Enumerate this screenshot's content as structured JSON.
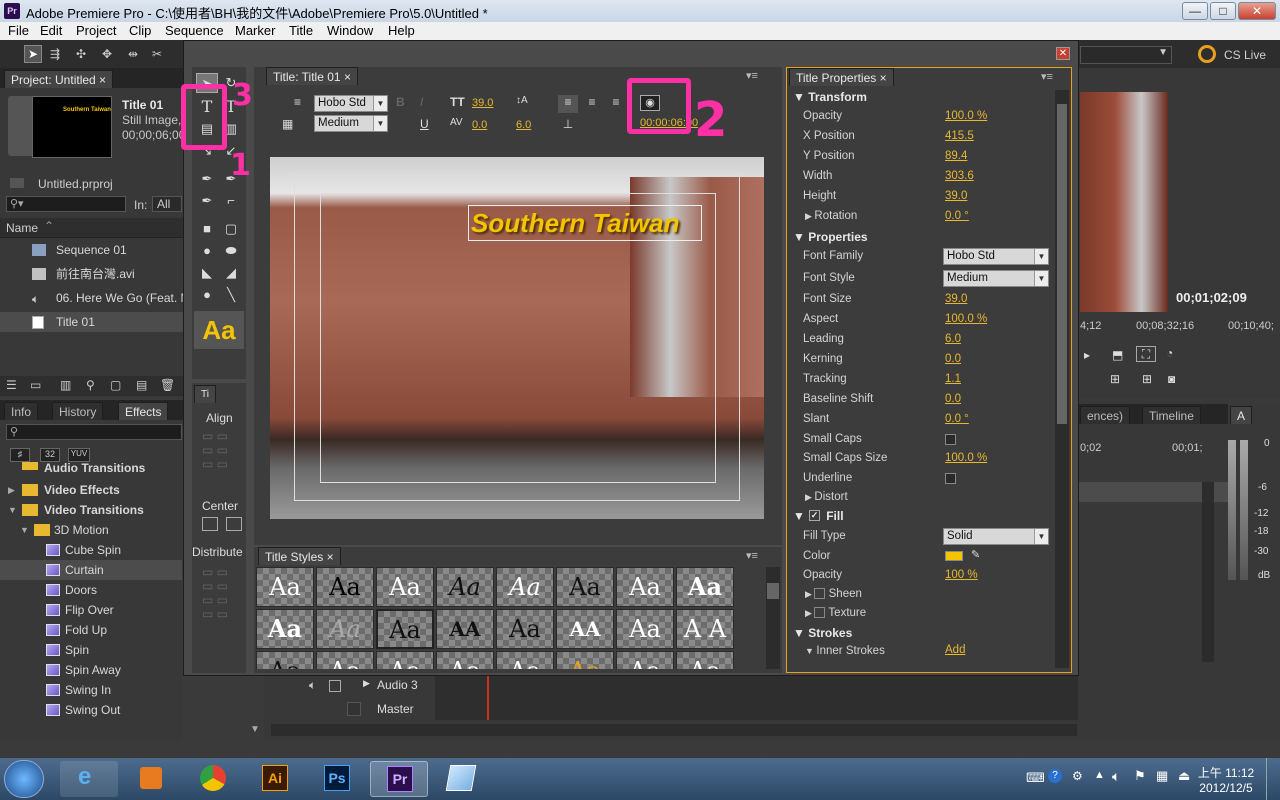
{
  "window": {
    "title": "Adobe Premiere Pro - C:\\使用者\\BH\\我的文件\\Adobe\\Premiere Pro\\5.0\\Untitled *",
    "app_icon": "Pr",
    "minimize": "—",
    "maximize": "□",
    "close": "✕"
  },
  "menu": [
    "File",
    "Edit",
    "Project",
    "Clip",
    "Sequence",
    "Marker",
    "Title",
    "Window",
    "Help"
  ],
  "cs_live": "CS Live",
  "project_panel": {
    "tab": "Project: Untitled",
    "clip_name": "Title 01",
    "clip_type": "Still Image,",
    "clip_duration": "00;00;06;00",
    "thumb_text": "Southern Taiwan",
    "project_file": "Untitled.prproj",
    "in_label": "In:",
    "in_value": "All",
    "name_header": "Name",
    "items": [
      "Sequence 01",
      "前往南台灣.avi",
      "06. Here We Go (Feat. M",
      "Title 01"
    ]
  },
  "effects_panel": {
    "tabs": [
      "Info",
      "History",
      "Effects"
    ],
    "badges": [
      "32",
      "YUV"
    ],
    "folders": [
      "Audio Transitions",
      "Video Effects",
      "Video Transitions",
      "3D Motion"
    ],
    "effects": [
      "Cube Spin",
      "Curtain",
      "Doors",
      "Flip Over",
      "Fold Up",
      "Spin",
      "Spin Away",
      "Swing In",
      "Swing Out"
    ]
  },
  "title_editor": {
    "tab": "Title: Title 01",
    "font_family": "Hobo Std",
    "font_style": "Medium",
    "font_size": "39.0",
    "kerning": "0.0",
    "leading": "6.0",
    "timecode": "00:00:06:00",
    "canvas_text": "Southern Taiwan",
    "aa_sample": "Aa"
  },
  "actions_panel": {
    "tab": "Ti",
    "align": "Align",
    "center": "Center",
    "distribute": "Distribute"
  },
  "title_styles": {
    "tab": "Title Styles",
    "cells": [
      "Aa",
      "Aa",
      "Aa",
      "Aa",
      "Aa",
      "Aa",
      "Aa",
      "Aa",
      "Aa",
      "Aa",
      "Aa",
      "AA",
      "Aa",
      "AA",
      "Aa",
      "A A",
      "Aa",
      "Aa",
      "Aa",
      "Aa",
      "Aa",
      "Aa",
      "Aa",
      "Aa"
    ]
  },
  "title_properties": {
    "tab": "Title Properties",
    "sections": {
      "transform": "Transform",
      "properties": "Properties",
      "fill": "Fill",
      "strokes": "Strokes"
    },
    "transform_rows": [
      {
        "label": "Opacity",
        "value": "100.0 %"
      },
      {
        "label": "X Position",
        "value": "415.5"
      },
      {
        "label": "Y Position",
        "value": "89.4"
      },
      {
        "label": "Width",
        "value": "303.6"
      },
      {
        "label": "Height",
        "value": "39.0"
      },
      {
        "label": "Rotation",
        "value": "0.0 °"
      }
    ],
    "property_rows": [
      {
        "label": "Font Family",
        "value": "Hobo Std"
      },
      {
        "label": "Font Style",
        "value": "Medium"
      },
      {
        "label": "Font Size",
        "value": "39.0"
      },
      {
        "label": "Aspect",
        "value": "100.0 %"
      },
      {
        "label": "Leading",
        "value": "6.0"
      },
      {
        "label": "Kerning",
        "value": "0.0"
      },
      {
        "label": "Tracking",
        "value": "1.1"
      },
      {
        "label": "Baseline Shift",
        "value": "0.0"
      },
      {
        "label": "Slant",
        "value": "0.0 °"
      },
      {
        "label": "Small Caps",
        "value": ""
      },
      {
        "label": "Small Caps Size",
        "value": "100.0 %"
      },
      {
        "label": "Underline",
        "value": ""
      },
      {
        "label": "Distort",
        "value": ""
      }
    ],
    "fill_rows": [
      {
        "label": "Fill Type",
        "value": "Solid"
      },
      {
        "label": "Color",
        "value": ""
      },
      {
        "label": "Opacity",
        "value": "100 %"
      },
      {
        "label": "Sheen",
        "value": ""
      },
      {
        "label": "Texture",
        "value": ""
      }
    ],
    "inner_strokes": "Inner Strokes",
    "add": "Add",
    "fill_color": "#f5c400"
  },
  "program_monitor": {
    "timecode": "00;01;02;09",
    "ruler": [
      "4;12",
      "00;08;32;16",
      "00;10;40;"
    ]
  },
  "timeline": {
    "tabs": [
      "ences)",
      "Timeline"
    ],
    "ruler": [
      "0;02",
      "00;01;"
    ],
    "tracks": [
      "Audio 3",
      "Master"
    ]
  },
  "audio_meter": {
    "tab": "A",
    "ticks": [
      "0",
      "-6",
      "-12",
      "-18",
      "-30",
      "dB"
    ]
  },
  "taskbar": {
    "clock_time": "上午 11:12",
    "clock_date": "2012/12/5",
    "apps": [
      "ie",
      "media",
      "chrome",
      "Ai",
      "Ps",
      "Pr",
      "notepad"
    ]
  },
  "annotations": [
    "1",
    "2",
    "3"
  ]
}
